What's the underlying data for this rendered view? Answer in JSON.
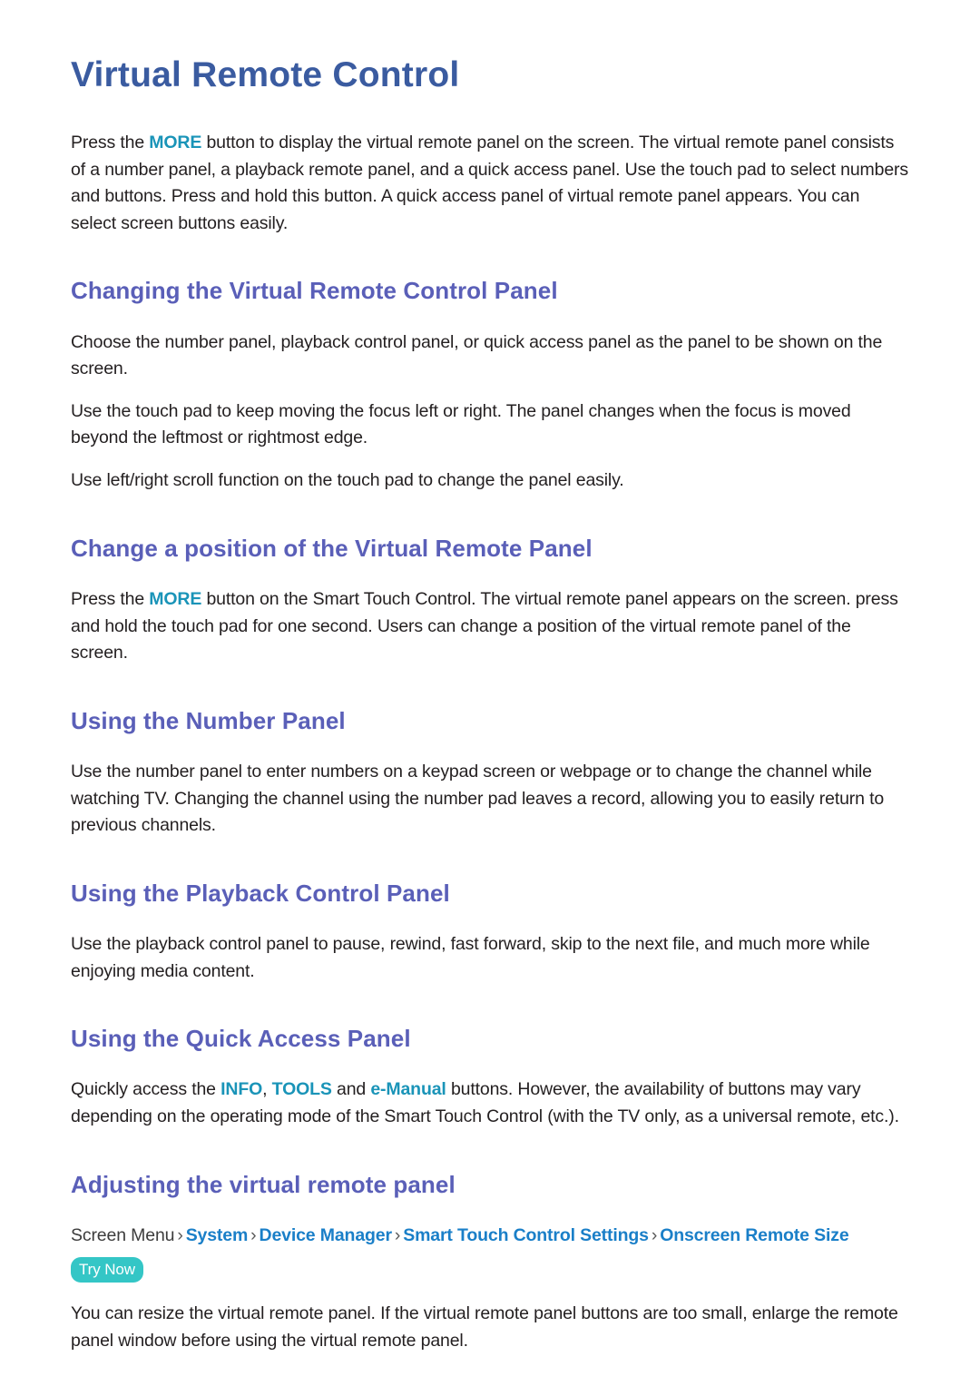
{
  "document": {
    "title": "Virtual Remote Control",
    "colors": {
      "title": "#3A5BA0",
      "heading": "#5A5FB8",
      "keyword": "#1A94B8",
      "breadcrumb_link": "#1A7FC8",
      "try_now_badge": "#34C6C6",
      "body_text": "#231F20",
      "background": "#FFFFFF"
    },
    "intro": {
      "part1": "Press the ",
      "keyword1": "MORE",
      "part2": " button to display the virtual remote panel on the screen. The virtual remote panel consists of a number panel, a playback remote panel, and a quick access panel. Use the touch pad to select numbers and buttons. Press and hold this button. A quick access panel of virtual remote panel appears. You can select screen buttons easily."
    },
    "sections": [
      {
        "heading": "Changing the Virtual Remote Control Panel",
        "paragraphs": [
          "Choose the number panel, playback control panel, or quick access panel as the panel to be shown on the screen.",
          "Use the touch pad to keep moving the focus left or right. The panel changes when the focus is moved beyond the leftmost or rightmost edge.",
          "Use left/right scroll function on the touch pad to change the panel easily."
        ]
      },
      {
        "heading": "Change a position of the Virtual Remote Panel",
        "rich_paragraph": {
          "part1": "Press the ",
          "keyword1": "MORE",
          "part2": " button on the Smart Touch Control. The virtual remote panel appears on the screen. press and hold the touch pad for one second. Users can change a position of the virtual remote panel of the screen."
        }
      },
      {
        "heading": "Using the Number Panel",
        "paragraphs": [
          "Use the number panel to enter numbers on a keypad screen or webpage or to change the channel while watching TV. Changing the channel using the number pad leaves a record, allowing you to easily return to previous channels."
        ]
      },
      {
        "heading": "Using the Playback Control Panel",
        "paragraphs": [
          "Use the playback control panel to pause, rewind, fast forward, skip to the next file, and much more while enjoying media content."
        ]
      },
      {
        "heading": "Using the Quick Access Panel",
        "rich_paragraph": {
          "part1": "Quickly access the ",
          "keyword1": "INFO",
          "part2": ", ",
          "keyword2": "TOOLS",
          "part3": " and ",
          "keyword3": "e-Manual",
          "part4": " buttons. However, the availability of buttons may vary depending on the operating mode of the Smart Touch Control (with the TV only, as a universal remote, etc.)."
        }
      },
      {
        "heading": "Adjusting the virtual remote panel",
        "menu_path": {
          "root": "Screen Menu",
          "separator": "›",
          "links": [
            "System",
            "Device Manager",
            "Smart Touch Control Settings",
            "Onscreen Remote Size"
          ],
          "badge": "Try Now"
        },
        "paragraphs": [
          "You can resize the virtual remote panel. If the virtual remote panel buttons are too small, enlarge the remote panel window before using the virtual remote panel."
        ]
      }
    ]
  }
}
